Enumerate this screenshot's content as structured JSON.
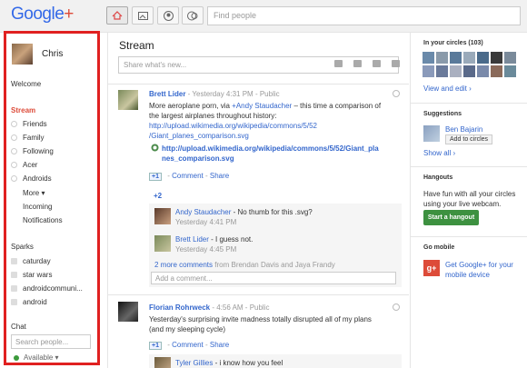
{
  "logo": {
    "text": "Google",
    "plus": "+"
  },
  "search": {
    "placeholder": "Find people"
  },
  "sidebar": {
    "profile_name": "Chris",
    "welcome": "Welcome",
    "stream": "Stream",
    "circles": [
      "Friends",
      "Family",
      "Following",
      "Acer",
      "Androids"
    ],
    "more": "More ▾",
    "incoming": "Incoming",
    "notifications": "Notifications",
    "sparks_head": "Sparks",
    "sparks": [
      "caturday",
      "star wars",
      "androidcommuni...",
      "android"
    ],
    "chat_head": "Chat",
    "chat_placeholder": "Search people...",
    "available": "Available ▾"
  },
  "main": {
    "title": "Stream",
    "share_placeholder": "Share what's new...",
    "post1": {
      "author": "Brett Lider",
      "meta": " -  Yesterday 4:31 PM  -  Public",
      "line1a": "More aeroplane porn, via ",
      "mention": "+Andy Staudacher",
      "line1b": " – this time a comparison of",
      "line2": "the largest airplanes throughout history:",
      "url1": "http://upload.wikimedia.org/wikipedia/commons/5/52",
      "url2": "/Giant_planes_comparison.svg",
      "linkbox1": "http://upload.wikimedia.org/wikipedia/commons/5/52/Giant_pla",
      "linkbox2": "nes_comparison.svg",
      "plusone": "+1",
      "comment": "Comment",
      "share": "Share",
      "plus_count": "+2",
      "comments": [
        {
          "author": "Andy Staudacher",
          "text": " - No thumb for this .svg?",
          "time": "Yesterday 4:41 PM"
        },
        {
          "author": "Brett Lider",
          "text": " - I guess not.",
          "time": "Yesterday 4:45 PM"
        }
      ],
      "more_comments_link": "2 more comments",
      "more_comments_rest": " from Brendan Davis and Jaya Frandy",
      "add_comment": "Add a comment..."
    },
    "post2": {
      "author": "Florian Rohrweck",
      "meta": " -  4:56 AM  -  Public",
      "line1": "Yesterday's surprising invite madness totally disrupted all of my plans",
      "line2": "(and my sleeping cycle)",
      "plusone": "+1",
      "comment": "Comment",
      "share": "Share",
      "comment_author": "Tyler Gillies",
      "comment_text": " - i know how you feel"
    }
  },
  "right": {
    "circles_head": "In your circles (103)",
    "view_edit": "View and edit ›",
    "suggestions_head": "Suggestions",
    "suggestion_name": "Ben Bajarin",
    "add_to_circles": "Add to circles",
    "show_all": "Show all ›",
    "hangouts_head": "Hangouts",
    "hangouts_text1": "Have fun with all your circles",
    "hangouts_text2": "using your live webcam.",
    "start_hangout": "Start a hangout",
    "mobile_head": "Go mobile",
    "mobile_link1": "Get Google+ for your",
    "mobile_link2": "mobile device",
    "gplus_icon": "g+"
  },
  "colors": {
    "accent_red": "#dd4b39",
    "link": "#3366cc",
    "hangout_green": "#3d9140",
    "highlight_border": "#e02020"
  }
}
